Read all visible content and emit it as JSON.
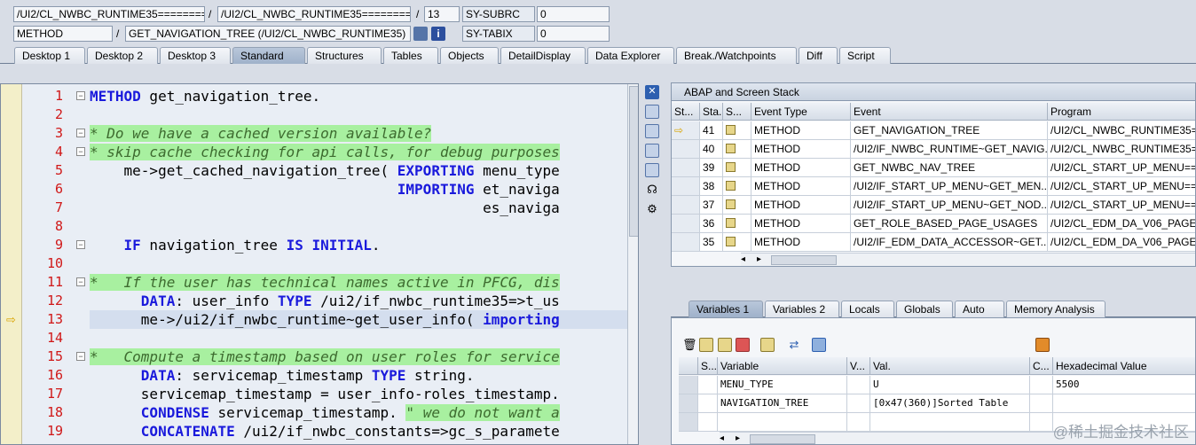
{
  "top": {
    "row1": {
      "program": "/UI2/CL_NWBC_RUNTIME35========...",
      "include": "/UI2/CL_NWBC_RUNTIME35========...",
      "line": "13",
      "sy_label": "SY-SUBRC",
      "sy_value": "0"
    },
    "row2": {
      "event_type": "METHOD",
      "event": "GET_NAVIGATION_TREE (/UI2/CL_NWBC_RUNTIME35)",
      "sy_label": "SY-TABIX",
      "sy_value": "0"
    },
    "slash": "/"
  },
  "tabs": [
    "Desktop 1",
    "Desktop 2",
    "Desktop 3",
    "Standard",
    "Structures",
    "Tables",
    "Objects",
    "DetailDisplay",
    "Data Explorer",
    "Break./Watchpoints",
    "Diff",
    "Script"
  ],
  "code": [
    {
      "n": "1",
      "fold": true,
      "html": "<span class='kw'>METHOD</span> get_navigation_tree."
    },
    {
      "n": "2",
      "fold": false,
      "html": ""
    },
    {
      "n": "3",
      "fold": true,
      "html": "<span class='cm cmbg'>* Do we have a cached version available?</span>"
    },
    {
      "n": "4",
      "fold": true,
      "html": "<span class='cm cmbg'>* skip cache checking for api calls, for debug purposes</span>"
    },
    {
      "n": "5",
      "fold": false,
      "html": "    me-&gt;get_cached_navigation_tree( <span class='kw'>EXPORTING</span> menu_type"
    },
    {
      "n": "6",
      "fold": false,
      "html": "                                    <span class='kw'>IMPORTING</span> et_naviga"
    },
    {
      "n": "7",
      "fold": false,
      "html": "                                              es_naviga"
    },
    {
      "n": "8",
      "fold": false,
      "html": ""
    },
    {
      "n": "9",
      "fold": true,
      "html": "    <span class='kw'>IF</span> navigation_tree <span class='kw'>IS INITIAL</span>."
    },
    {
      "n": "10",
      "fold": false,
      "html": ""
    },
    {
      "n": "11",
      "fold": true,
      "html": "<span class='cm cmbg'>*   If the user has technical names active in PFCG, dis</span>"
    },
    {
      "n": "12",
      "fold": false,
      "html": "      <span class='kw'>DATA</span>: user_info <span class='kw'>TYPE</span> /ui2/if_nwbc_runtime35=&gt;t_us"
    },
    {
      "n": "13",
      "fold": false,
      "html": "      me-&gt;/ui2/if_nwbc_runtime~get_user_info( <span class='kw'>importing</span>"
    },
    {
      "n": "14",
      "fold": false,
      "html": ""
    },
    {
      "n": "15",
      "fold": true,
      "html": "<span class='cm cmbg'>*   Compute a timestamp based on user roles for service</span>"
    },
    {
      "n": "16",
      "fold": false,
      "html": "      <span class='kw'>DATA</span>: servicemap_timestamp <span class='kw'>TYPE</span> string."
    },
    {
      "n": "17",
      "fold": false,
      "html": "      servicemap_timestamp = user_info-roles_timestamp."
    },
    {
      "n": "18",
      "fold": false,
      "html": "      <span class='kw'>CONDENSE</span> servicemap_timestamp. <span class='cm cmbg'>\" we do not want a</span>"
    },
    {
      "n": "19",
      "fold": false,
      "html": "      <span class='kw'>CONCATENATE</span> /ui2/if_nwbc_constants=&gt;gc_s_paramete"
    }
  ],
  "stack": {
    "title": "ABAP and Screen Stack",
    "headers": [
      "St...",
      "Sta...",
      "S...",
      "Event Type",
      "Event",
      "Program"
    ],
    "rows": [
      {
        "current": true,
        "level": "41",
        "type": "METHOD",
        "event": "GET_NAVIGATION_TREE",
        "program": "/UI2/CL_NWBC_RUNTIME35=="
      },
      {
        "current": false,
        "level": "40",
        "type": "METHOD",
        "event": "/UI2/IF_NWBC_RUNTIME~GET_NAVIG...",
        "program": "/UI2/CL_NWBC_RUNTIME35=="
      },
      {
        "current": false,
        "level": "39",
        "type": "METHOD",
        "event": "GET_NWBC_NAV_TREE",
        "program": "/UI2/CL_START_UP_MENU=="
      },
      {
        "current": false,
        "level": "38",
        "type": "METHOD",
        "event": "/UI2/IF_START_UP_MENU~GET_MEN...",
        "program": "/UI2/CL_START_UP_MENU=="
      },
      {
        "current": false,
        "level": "37",
        "type": "METHOD",
        "event": "/UI2/IF_START_UP_MENU~GET_NOD...",
        "program": "/UI2/CL_START_UP_MENU=="
      },
      {
        "current": false,
        "level": "36",
        "type": "METHOD",
        "event": "GET_ROLE_BASED_PAGE_USAGES",
        "program": "/UI2/CL_EDM_DA_V06_PAGE_"
      },
      {
        "current": false,
        "level": "35",
        "type": "METHOD",
        "event": "/UI2/IF_EDM_DATA_ACCESSOR~GET...",
        "program": "/UI2/CL_EDM_DA_V06_PAGE_"
      }
    ]
  },
  "var_tabs": [
    "Variables 1",
    "Variables 2",
    "Locals",
    "Globals",
    "Auto",
    "Memory Analysis"
  ],
  "vars": {
    "headers": [
      "S...",
      "Variable",
      "V...",
      "Val.",
      "C...",
      "Hexadecimal Value"
    ],
    "rows": [
      {
        "name": "MENU_TYPE",
        "value": "U",
        "hex": "5500"
      },
      {
        "name": "NAVIGATION_TREE",
        "value": "[0x47(360)]Sorted Table",
        "hex": ""
      }
    ]
  },
  "watermark": "@稀土掘金技术社区",
  "colors": {
    "keyword": "#1a1adc",
    "comment_bg": "#a8f0a0",
    "line_number": "#d01818"
  }
}
